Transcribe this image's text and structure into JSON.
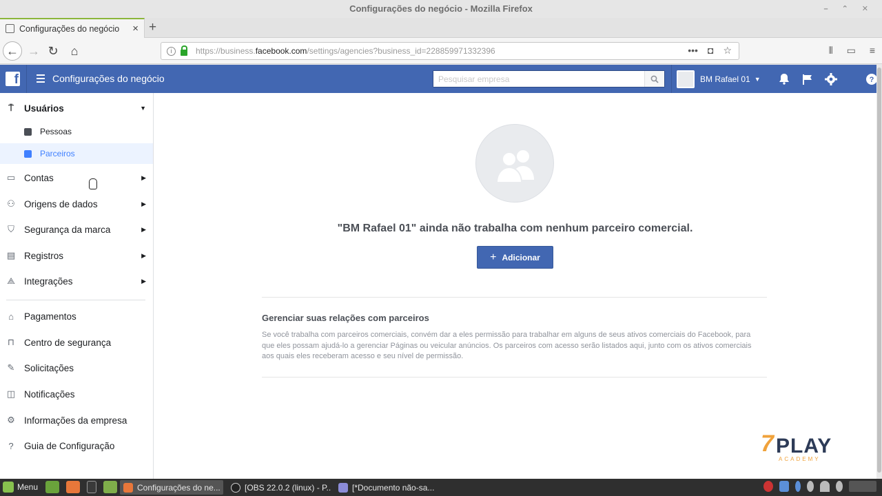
{
  "window": {
    "title": "Configurações do negócio - Mozilla Firefox"
  },
  "browser": {
    "tab_title": "Configurações do negócio",
    "tab_close": "×",
    "new_tab": "+",
    "url_prefix": "https://business.",
    "url_host": "facebook.com",
    "url_path": "/settings/agencies?business_id=228859971332396"
  },
  "fb": {
    "logo": "f",
    "title": "Configurações do negócio",
    "search_placeholder": "Pesquisar empresa",
    "account_name": "BM Rafael 01"
  },
  "sidebar": {
    "users": "Usuários",
    "people": "Pessoas",
    "partners": "Parceiros",
    "items": [
      {
        "label": "Contas"
      },
      {
        "label": "Origens de dados"
      },
      {
        "label": "Segurança da marca"
      },
      {
        "label": "Registros"
      },
      {
        "label": "Integrações"
      }
    ],
    "bottom": [
      {
        "label": "Pagamentos"
      },
      {
        "label": "Centro de segurança"
      },
      {
        "label": "Solicitações"
      },
      {
        "label": "Notificações"
      },
      {
        "label": "Informações da empresa"
      },
      {
        "label": "Guia de Configuração"
      }
    ]
  },
  "main": {
    "headline": "\"BM Rafael 01\" ainda não trabalha com nenhum parceiro comercial.",
    "add_button": "Adicionar",
    "section_title": "Gerenciar suas relações com parceiros",
    "section_body": "Se você trabalha com parceiros comerciais, convém dar a eles permissão para trabalhar em alguns de seus ativos comerciais do Facebook, para que eles possam ajudá-lo a gerenciar Páginas ou veicular anúncios. Os parceiros com acesso serão listados aqui, junto com os ativos comerciais aos quais eles receberam acesso e seu nível de permissão."
  },
  "watermark": {
    "number": "7",
    "word": "PLAY",
    "sub": "ACADEMY"
  },
  "taskbar": {
    "menu": "Menu",
    "windows": [
      {
        "label": "Configurações do ne..."
      },
      {
        "label": "[OBS 22.0.2 (linux) - P..."
      },
      {
        "label": "[*Documento não-sa..."
      }
    ]
  },
  "colors": {
    "fb_blue": "#4267b2",
    "active_blue": "#4080ff"
  }
}
